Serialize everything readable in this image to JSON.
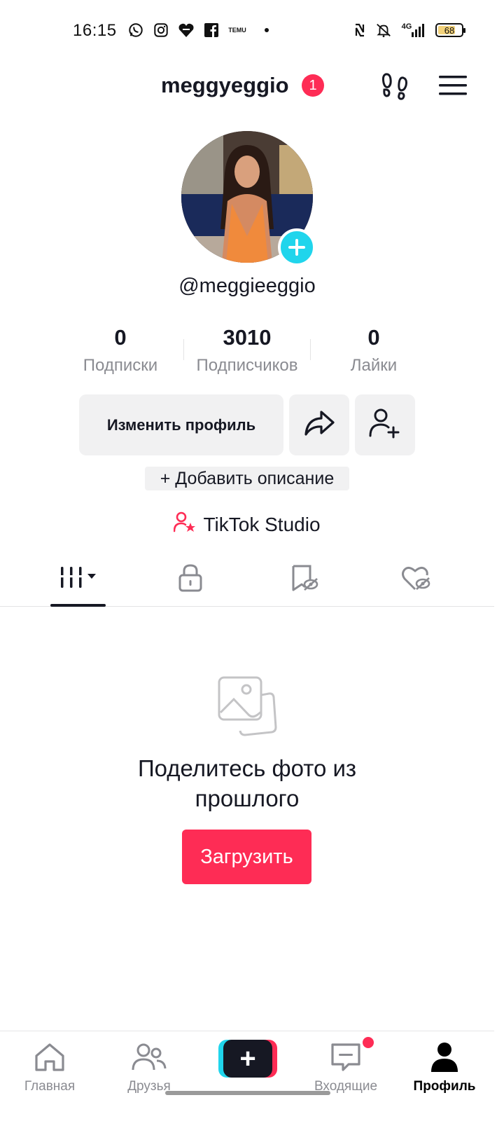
{
  "status_bar": {
    "time": "16:15",
    "network": "4G",
    "battery": "68",
    "left_icons": [
      "whatsapp-icon",
      "instagram-icon",
      "heart-app-icon",
      "facebook-icon",
      "temu-icon"
    ],
    "temu_text": "TEMU",
    "right_icons": [
      "nfc-icon",
      "mute-icon",
      "signal-icon",
      "battery-icon"
    ]
  },
  "header": {
    "username": "meggyeggio",
    "notification_count": "1"
  },
  "profile": {
    "handle": "@meggieeggio",
    "stats": [
      {
        "value": "0",
        "label": "Подписки"
      },
      {
        "value": "3010",
        "label": "Подписчиков"
      },
      {
        "value": "0",
        "label": "Лайки"
      }
    ],
    "edit_button": "Изменить профиль",
    "add_description": "+ Добавить описание",
    "studio_link": "TikTok Studio"
  },
  "tabs": [
    {
      "name": "videos",
      "icon": "grid-icon",
      "active": true
    },
    {
      "name": "private",
      "icon": "lock-icon",
      "active": false
    },
    {
      "name": "saved",
      "icon": "bookmark-hidden-icon",
      "active": false
    },
    {
      "name": "liked",
      "icon": "heart-hidden-icon",
      "active": false
    }
  ],
  "empty_state": {
    "title": "Поделитесь фото из прошлого",
    "button": "Загрузить"
  },
  "bottom_nav": [
    {
      "label": "Главная",
      "icon": "home-icon"
    },
    {
      "label": "Друзья",
      "icon": "friends-icon"
    },
    {
      "label": "",
      "icon": "create-plus-icon"
    },
    {
      "label": "Входящие",
      "icon": "inbox-icon"
    },
    {
      "label": "Профиль",
      "icon": "profile-icon"
    }
  ],
  "colors": {
    "accent": "#fe2c55",
    "cyan": "#20d5ec",
    "text": "#161823",
    "muted": "#8a8b91"
  }
}
